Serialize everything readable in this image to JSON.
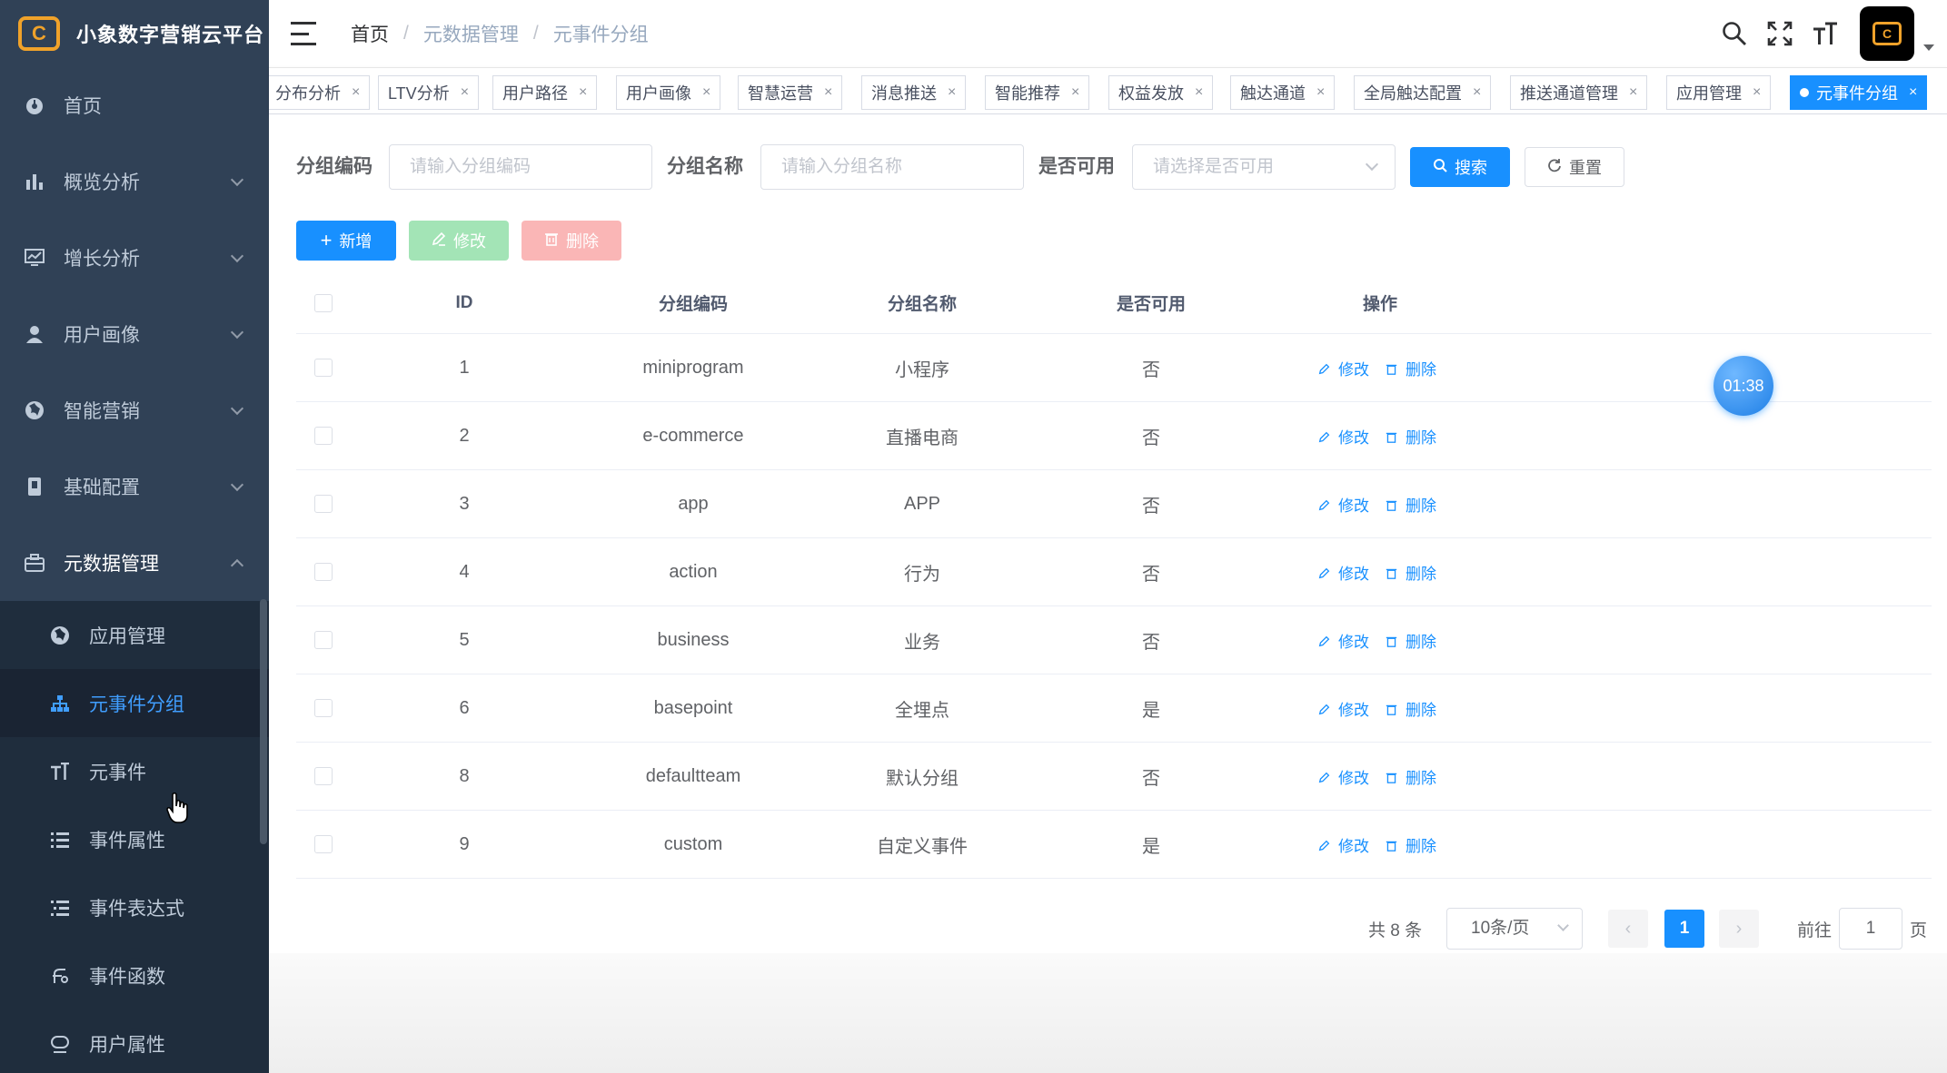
{
  "app": {
    "title": "小象数字营销云平台",
    "logo_mark": "C"
  },
  "sidebar": {
    "items": [
      {
        "label": "首页",
        "icon": "dashboard-icon"
      },
      {
        "label": "概览分析",
        "icon": "bar-chart-icon"
      },
      {
        "label": "增长分析",
        "icon": "monitor-chart-icon"
      },
      {
        "label": "用户画像",
        "icon": "user-icon"
      },
      {
        "label": "智能营销",
        "icon": "globe-icon"
      },
      {
        "label": "基础配置",
        "icon": "book-icon"
      },
      {
        "label": "元数据管理",
        "icon": "briefcase-icon"
      }
    ],
    "sub_items": [
      {
        "label": "应用管理",
        "icon": "globe-icon"
      },
      {
        "label": "元事件分组",
        "icon": "tree-icon"
      },
      {
        "label": "元事件",
        "icon": "text-size-icon"
      },
      {
        "label": "事件属性",
        "icon": "list-icon"
      },
      {
        "label": "事件表达式",
        "icon": "list-tree-icon"
      },
      {
        "label": "事件函数",
        "icon": "function-icon"
      },
      {
        "label": "用户属性",
        "icon": "user-attr-icon"
      }
    ]
  },
  "breadcrumb": {
    "home": "首页",
    "level1": "元数据管理",
    "level2": "元事件分组",
    "sep": "/"
  },
  "tags": [
    "分布分析",
    "LTV分析",
    "用户路径",
    "用户画像",
    "智慧运营",
    "消息推送",
    "智能推荐",
    "权益发放",
    "触达通道",
    "全局触达配置",
    "推送通道管理",
    "应用管理",
    "元事件分组"
  ],
  "search": {
    "code_label": "分组编码",
    "code_placeholder": "请输入分组编码",
    "name_label": "分组名称",
    "name_placeholder": "请输入分组名称",
    "enabled_label": "是否可用",
    "enabled_placeholder": "请选择是否可用",
    "search_btn": "搜索",
    "reset_btn": "重置"
  },
  "toolbar": {
    "add": "新增",
    "edit": "修改",
    "delete": "删除"
  },
  "table": {
    "headers": [
      "ID",
      "分组编码",
      "分组名称",
      "是否可用",
      "操作"
    ],
    "rows": [
      {
        "id": "1",
        "code": "miniprogram",
        "name": "小程序",
        "enabled": "否"
      },
      {
        "id": "2",
        "code": "e-commerce",
        "name": "直播电商",
        "enabled": "否"
      },
      {
        "id": "3",
        "code": "app",
        "name": "APP",
        "enabled": "否"
      },
      {
        "id": "4",
        "code": "action",
        "name": "行为",
        "enabled": "否"
      },
      {
        "id": "5",
        "code": "business",
        "name": "业务",
        "enabled": "否"
      },
      {
        "id": "6",
        "code": "basepoint",
        "name": "全埋点",
        "enabled": "是"
      },
      {
        "id": "8",
        "code": "defaultteam",
        "name": "默认分组",
        "enabled": "否"
      },
      {
        "id": "9",
        "code": "custom",
        "name": "自定义事件",
        "enabled": "是"
      }
    ],
    "op_edit": "修改",
    "op_delete": "删除"
  },
  "pagination": {
    "total": "共 8 条",
    "page_size": "10条/页",
    "current": "1",
    "goto_prefix": "前往",
    "goto_value": "1",
    "goto_suffix": "页"
  },
  "overlay": {
    "timer": "01:38"
  },
  "colors": {
    "primary": "#1890ff",
    "sidebar": "#304156",
    "success_light": "#a3e4b6",
    "danger_light": "#fab6b6"
  }
}
